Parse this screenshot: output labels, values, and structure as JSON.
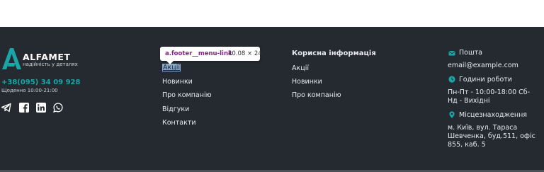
{
  "brand": {
    "name": "ALFAMET",
    "tagline": "надійність у деталях",
    "accent": "#1aa6a6"
  },
  "contact": {
    "phone": "+38(095) 34 09 928",
    "hours": "Щоденно 10:00-21:00"
  },
  "social": [
    "telegram-icon",
    "facebook-icon",
    "linkedin-icon",
    "whatsapp-icon"
  ],
  "menu": {
    "items": [
      "Акції",
      "Новинки",
      "Про компанію",
      "Відгуки",
      "Контакти"
    ]
  },
  "devtools_tooltip": {
    "selector": "a.footer__menu-link",
    "size": "40.08 × 24"
  },
  "useful": {
    "title": "Корисна інформація",
    "items": [
      "Акції",
      "Новинки",
      "Про компанію"
    ]
  },
  "info": {
    "mail_label": "Пошта",
    "email": "email@example.com",
    "hours_label": "Години роботи",
    "hours": "Пн-Пт - 10:00-18:00 Сб-Нд - Вихідні",
    "location_label": "Місцезнаходження",
    "address": "м. Київ, вул. Тараса Шевченка, буд.511, офіс 855, каб. 5"
  }
}
